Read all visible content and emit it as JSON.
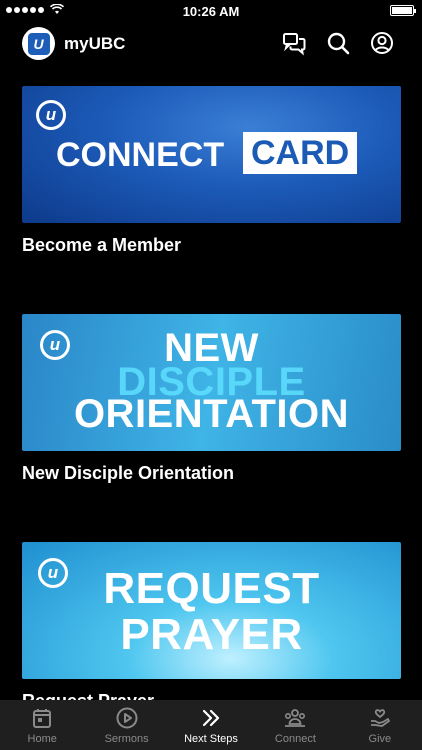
{
  "status_bar": {
    "time": "10:26 AM"
  },
  "header": {
    "title": "myUBC"
  },
  "cards": [
    {
      "banner_line_1": "CONNECT",
      "banner_line_2": "CARD",
      "title": "Become a Member"
    },
    {
      "banner_line_1": "NEW",
      "banner_line_2": "DISCIPLE",
      "banner_line_3": "ORIENTATION",
      "title": "New Disciple Orientation"
    },
    {
      "banner_line_1": "REQUEST",
      "banner_line_2": "PRAYER",
      "title": "Request Prayer"
    }
  ],
  "tabs": [
    {
      "label": "Home",
      "icon": "calendar-icon"
    },
    {
      "label": "Sermons",
      "icon": "play-circle-icon"
    },
    {
      "label": "Next Steps",
      "icon": "double-chevron-icon"
    },
    {
      "label": "Connect",
      "icon": "group-icon"
    },
    {
      "label": "Give",
      "icon": "heart-hand-icon"
    }
  ],
  "colors": {
    "tab_active": "#ffffff",
    "tab_inactive": "#8a8a8a",
    "tab_bar_bg": "#1f1f1f",
    "brand_blue": "#1e5eb8"
  }
}
